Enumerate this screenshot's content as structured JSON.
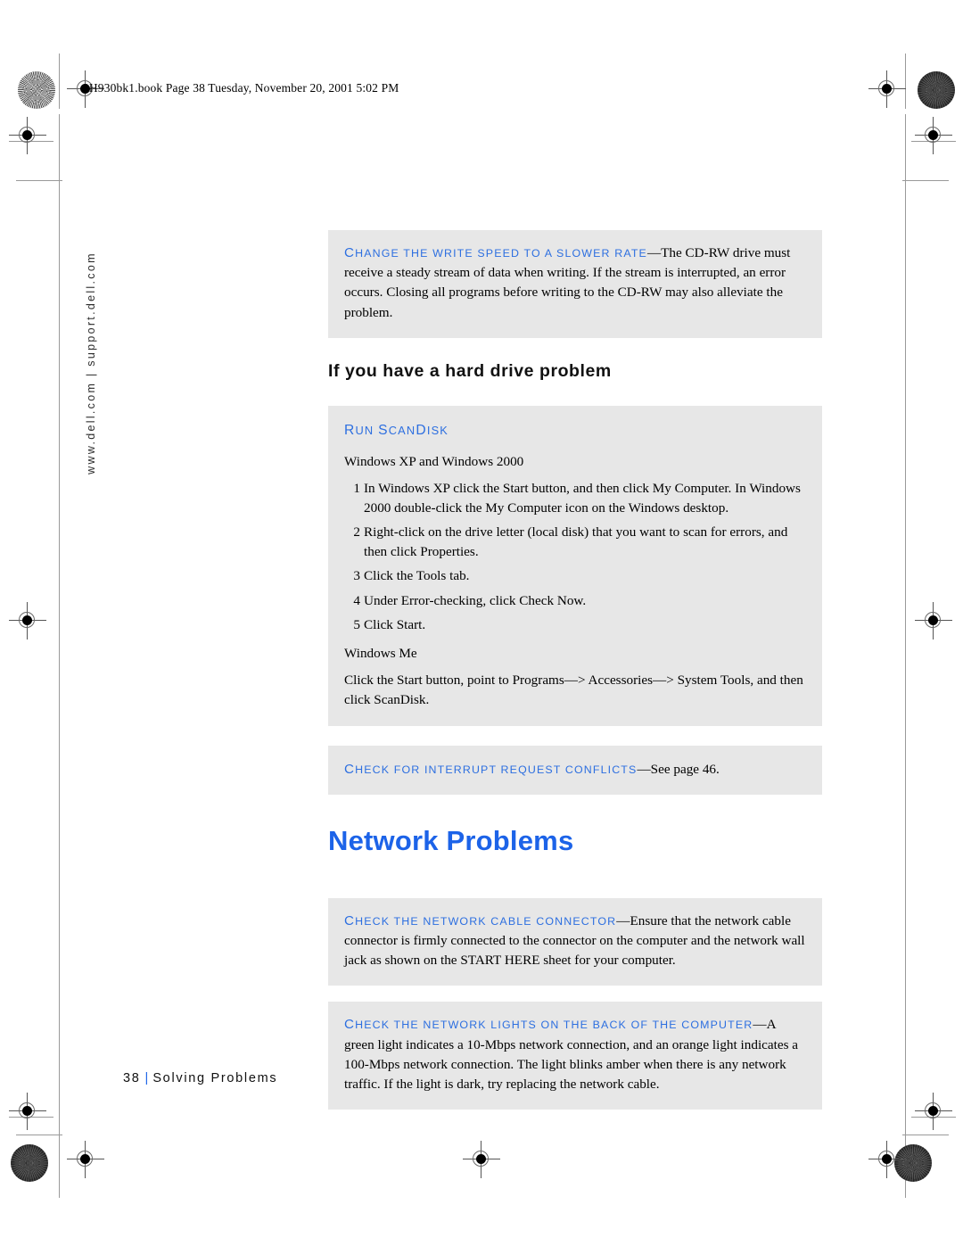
{
  "page": {
    "file_header": "2H930bk1.book  Page 38  Tuesday, November 20, 2001  5:02 PM",
    "side_url": "www.dell.com | support.dell.com",
    "footer_page_number": "38",
    "footer_separator": "|",
    "footer_section": "Solving Problems",
    "colors": {
      "accent_blue": "#1c63e8",
      "term_blue": "#2d6fe0",
      "box_gray": "#e7e7e7",
      "page_white": "#ffffff"
    }
  },
  "boxes": {
    "cdrw_write_speed": {
      "term_cap": "C",
      "term_rest": "HANGE THE WRITE SPEED TO A SLOWER RATE",
      "dash": "—",
      "body": "The CD-RW drive must receive a steady stream of data when writing. If the stream is interrupted, an error occurs. Closing all programs before writing to the CD-RW may also alleviate the problem."
    },
    "run_scandisk": {
      "term_cap": "R",
      "term_rest": "UN ",
      "term_cap2": "S",
      "term_rest2": "CAN",
      "term_cap3": "D",
      "term_rest3": "ISK",
      "os_line_1": "Windows XP and Windows 2000",
      "steps": [
        {
          "num": "1",
          "text": "In Windows XP click the Start button, and then click My Computer. In Windows 2000 double-click the My Computer icon on the Windows desktop."
        },
        {
          "num": "2",
          "text": "Right-click on the drive letter (local disk) that you want to scan for errors, and then click Properties."
        },
        {
          "num": "3",
          "text": "Click the Tools tab."
        },
        {
          "num": "4",
          "text": "Under Error-checking, click Check Now."
        },
        {
          "num": "5",
          "text": "Click Start."
        }
      ],
      "os_line_2": "Windows Me",
      "me_instructions": "Click the Start button, point to Programs—>  Accessories—>  System Tools, and then click ScanDisk."
    },
    "interrupt_conflicts": {
      "term_cap": "C",
      "term_rest": "HECK FOR INTERRUPT REQUEST CONFLICTS",
      "dash": "—",
      "body": "See page 46."
    },
    "network_cable_connector": {
      "term_cap": "C",
      "term_rest": "HECK THE NETWORK CABLE CONNECTOR",
      "dash": "—",
      "body": "Ensure that the network cable connector is firmly connected to the connector on the computer and the network wall jack as shown on the START HERE sheet for your computer."
    },
    "network_lights": {
      "term_cap": "C",
      "term_rest": "HECK THE NETWORK LIGHTS ON THE BACK OF THE COMPUTER",
      "dash": "—",
      "body": "A green light indicates a 10-Mbps network connection, and an orange light indicates a 100-Mbps network connection. The light blinks amber when there is any network traffic. If the light is dark, try replacing the network cable."
    }
  },
  "headings": {
    "hard_drive_section": "If you have a hard drive problem",
    "network_problems": "Network Problems"
  }
}
